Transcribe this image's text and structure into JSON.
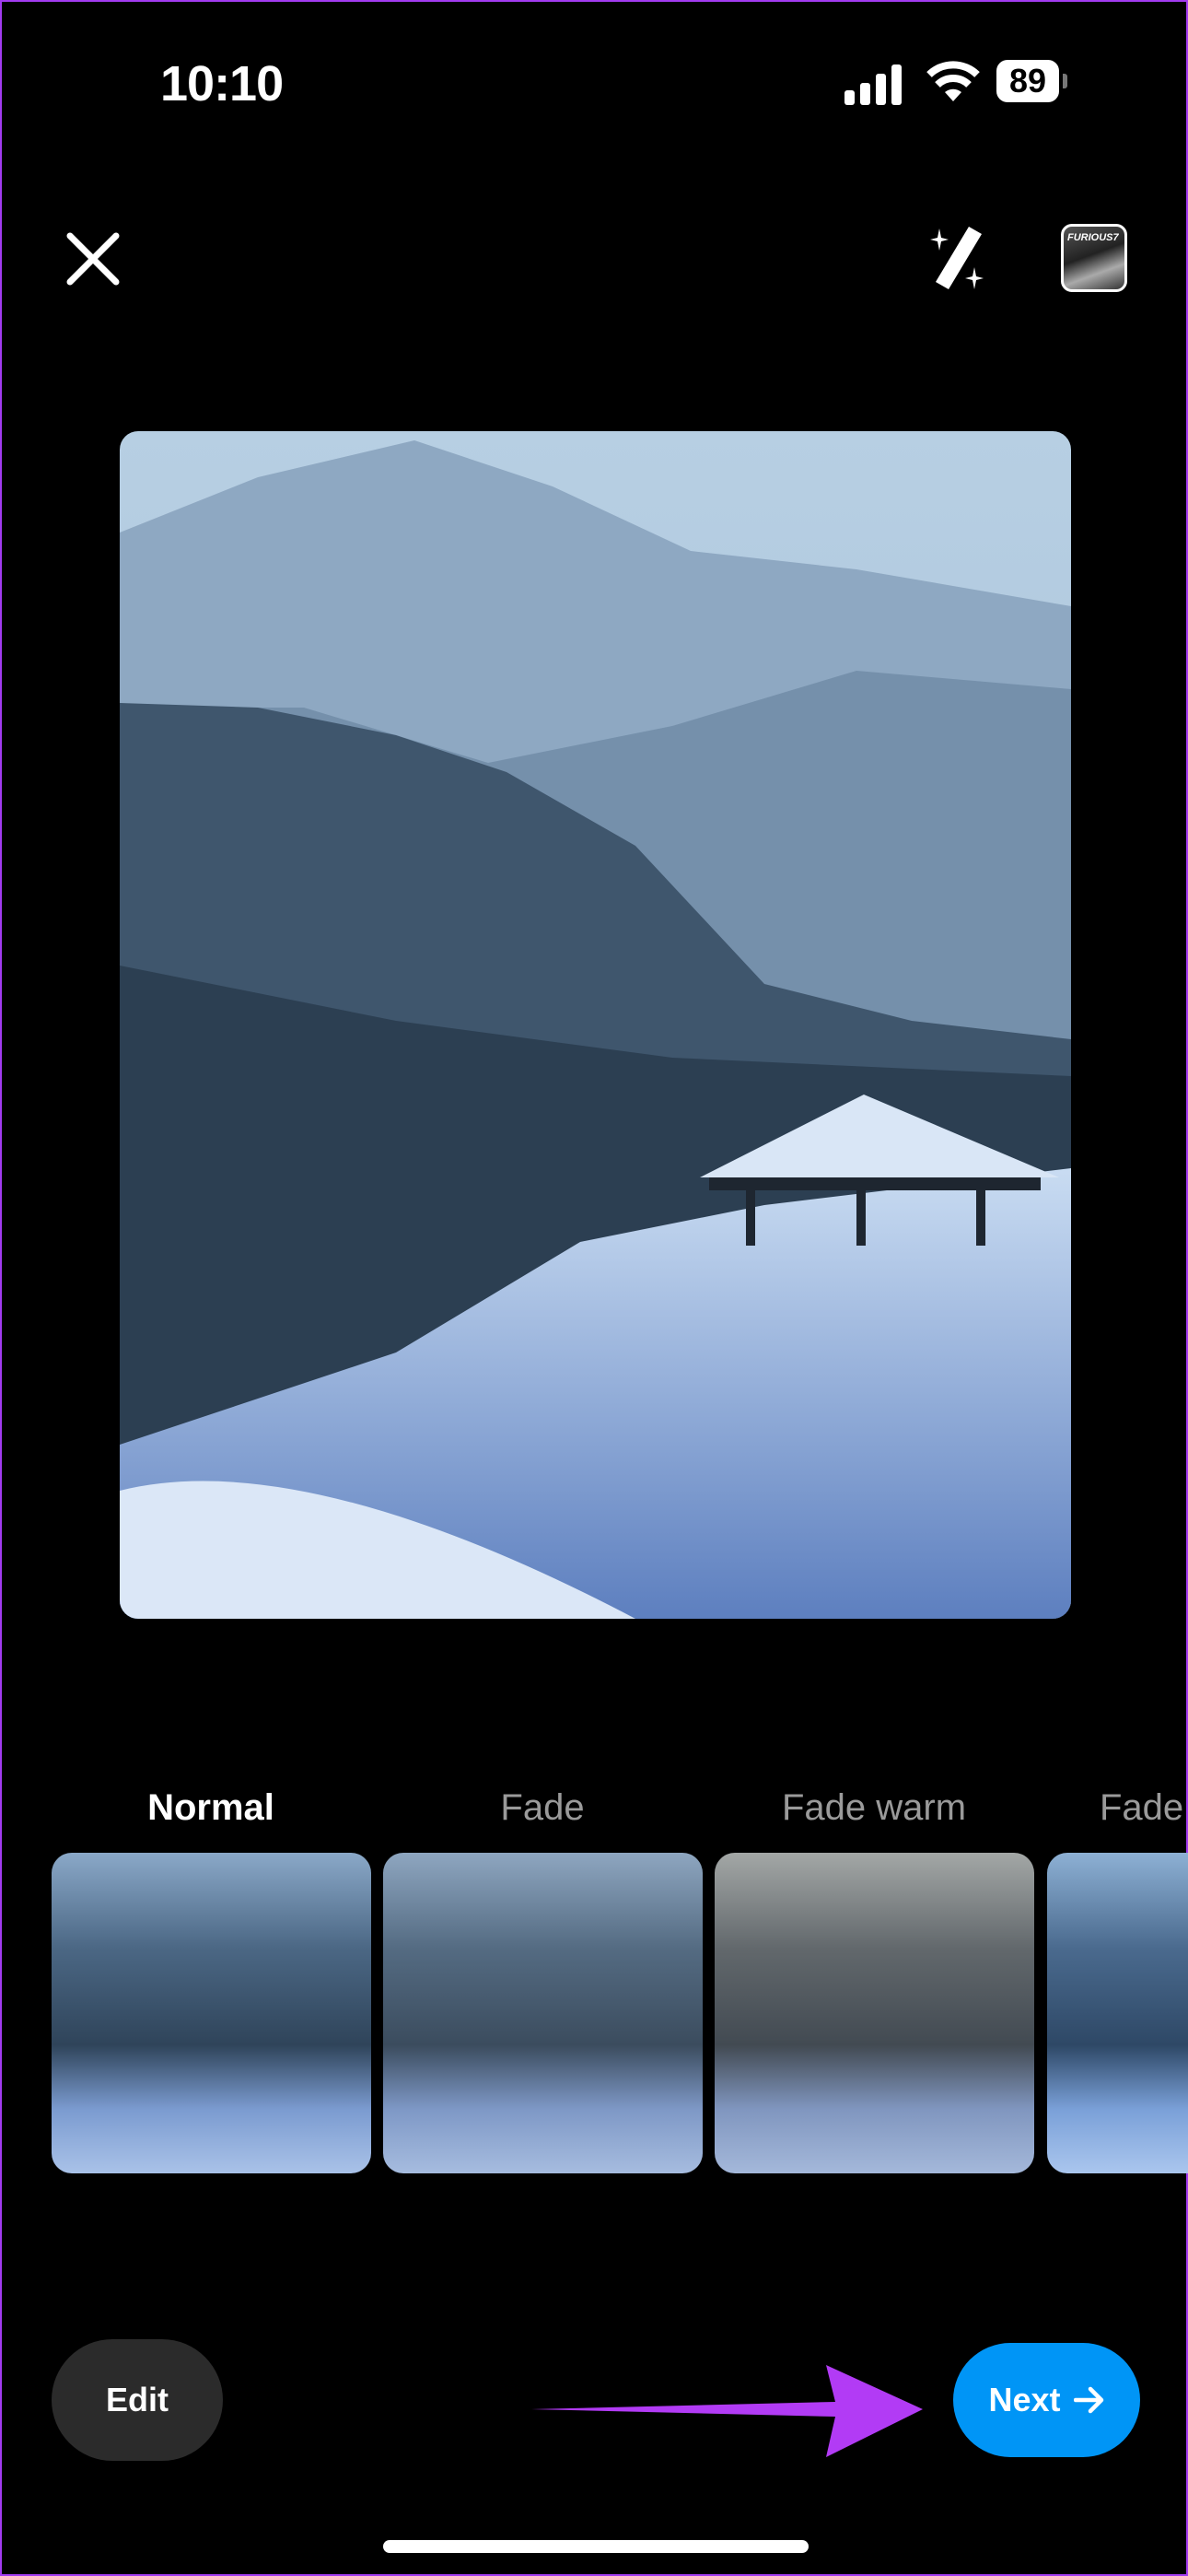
{
  "status_bar": {
    "time": "10:10",
    "battery": "89"
  },
  "toolbar": {
    "close_icon": "close-icon",
    "magic_icon": "magic-wand-icon",
    "thumbnail_text": "FURIOUS7"
  },
  "filters": [
    {
      "label": "Normal",
      "selected": true
    },
    {
      "label": "Fade",
      "selected": false
    },
    {
      "label": "Fade warm",
      "selected": false
    },
    {
      "label": "Fade",
      "selected": false
    }
  ],
  "footer": {
    "edit_label": "Edit",
    "next_label": "Next"
  },
  "colors": {
    "accent": "#0095f6",
    "annotation": "#b23bf5",
    "edit_bg": "#2b2b2b"
  }
}
